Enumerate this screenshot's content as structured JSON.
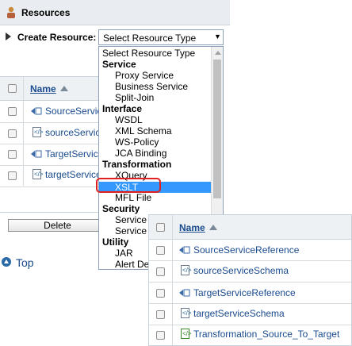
{
  "header": {
    "title": "Resources"
  },
  "create": {
    "label": "Create Resource:",
    "selected": "Select Resource Type"
  },
  "table": {
    "name_header": "Name",
    "rows": [
      "SourceService",
      "sourceService",
      "TargetService",
      "targetService"
    ]
  },
  "delete_label": "Delete",
  "top_label": "Top",
  "dropdown": {
    "first": "Select Resource Type",
    "groups": [
      {
        "label": "Service",
        "items": [
          "Proxy Service",
          "Business Service",
          "Split-Join"
        ]
      },
      {
        "label": "Interface",
        "items": [
          "WSDL",
          "XML Schema",
          "WS-Policy",
          "JCA Binding"
        ]
      },
      {
        "label": "Transformation",
        "items": [
          "XQuery",
          "XSLT",
          "MFL File"
        ]
      },
      {
        "label": "Security",
        "items": [
          "Service",
          "Service"
        ]
      },
      {
        "label": "Utility",
        "items": [
          "JAR",
          "Alert De"
        ]
      }
    ],
    "highlighted": "XSLT",
    "highlight_color": "#3399ff",
    "callout_color": "#e02020"
  },
  "panel": {
    "name_header": "Name",
    "rows": [
      "SourceServiceReference",
      "sourceServiceSchema",
      "TargetServiceReference",
      "targetServiceSchema",
      "Transformation_Source_To_Target"
    ]
  }
}
